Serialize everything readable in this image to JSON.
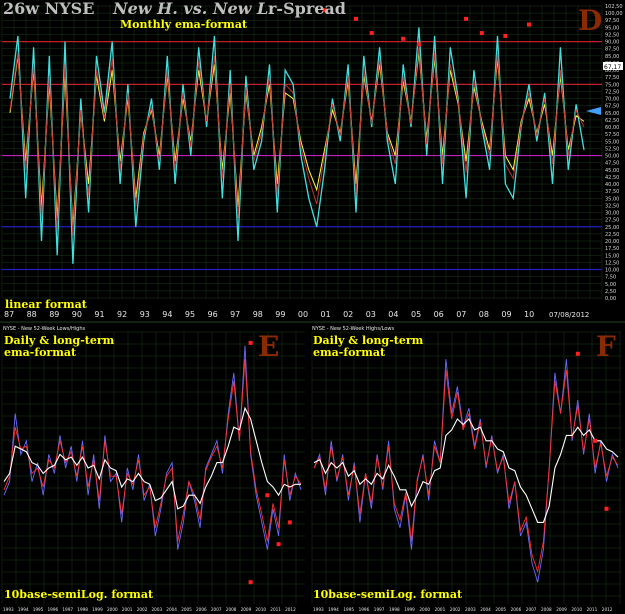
{
  "chart_data": [
    {
      "type": "line",
      "panel": "D",
      "title": "26w NYSE",
      "title_italic": "New H. vs. New L.",
      "title_suffix": "r-Spread",
      "subtitle": "Monthly ema-format",
      "format_label": "linear format",
      "date_label": "07/08/2012",
      "current_value_label": "67,17",
      "panel_letter": "D",
      "x_tick_labels": [
        "87",
        "88",
        "89",
        "90",
        "91",
        "92",
        "93",
        "94",
        "95",
        "96",
        "97",
        "98",
        "99",
        "00",
        "01",
        "02",
        "03",
        "04",
        "05",
        "06",
        "07",
        "08",
        "09",
        "10"
      ],
      "ylim": [
        0,
        102.5
      ],
      "y_tick_labels": [
        "102,50",
        "100,00",
        "97,50",
        "95,00",
        "92,50",
        "90,00",
        "87,50",
        "85,00",
        "82,50",
        "80,00",
        "77,50",
        "75,00",
        "72,50",
        "70,00",
        "67,50",
        "65,00",
        "62,50",
        "60,00",
        "57,50",
        "55,00",
        "52,50",
        "50,00",
        "47,50",
        "45,00",
        "42,50",
        "40,00",
        "37,50",
        "35,00",
        "32,50",
        "30,00",
        "27,50",
        "25,00",
        "22,50",
        "20,00",
        "17,50",
        "15,00",
        "12,50",
        "10,00",
        "7,50",
        "5,00",
        "2,50",
        "0,00"
      ],
      "reference_lines": [
        {
          "value": 90,
          "color": "#c0202a"
        },
        {
          "value": 75,
          "color": "#c0202a"
        },
        {
          "value": 50,
          "color": "#c020c0"
        },
        {
          "value": 25,
          "color": "#2020c0"
        },
        {
          "value": 10,
          "color": "#2020c0"
        }
      ],
      "series": [
        {
          "color": "#40e0e0",
          "values": [
            70,
            92,
            35,
            88,
            20,
            85,
            15,
            90,
            12,
            70,
            30,
            85,
            65,
            90,
            40,
            75,
            25,
            55,
            70,
            45,
            85,
            40,
            75,
            50,
            88,
            60,
            92,
            35,
            80,
            20,
            78,
            45,
            55,
            82,
            30,
            80,
            75,
            50,
            35,
            25,
            45,
            70,
            55,
            82,
            30,
            85,
            60,
            88,
            55,
            40,
            82,
            60,
            95,
            50,
            92,
            40,
            88,
            70,
            35,
            80,
            60,
            45,
            92,
            40,
            35,
            60,
            75,
            55,
            72,
            40,
            88,
            45,
            68,
            52
          ]
        },
        {
          "color": "#ffff40",
          "values": [
            65,
            85,
            48,
            80,
            32,
            75,
            28,
            78,
            25,
            65,
            40,
            78,
            62,
            80,
            48,
            70,
            35,
            58,
            66,
            50,
            78,
            48,
            70,
            55,
            80,
            62,
            82,
            45,
            72,
            32,
            72,
            50,
            60,
            75,
            40,
            72,
            70,
            55,
            45,
            38,
            52,
            66,
            58,
            76,
            40,
            78,
            62,
            82,
            58,
            50,
            76,
            62,
            86,
            56,
            84,
            50,
            80,
            68,
            48,
            74,
            62,
            52,
            84,
            50,
            45,
            62,
            70,
            58,
            68,
            50,
            78,
            52,
            64,
            62
          ]
        },
        {
          "color": "#c03030",
          "values": [
            66,
            86,
            45,
            82,
            28,
            78,
            24,
            82,
            22,
            66,
            36,
            80,
            63,
            84,
            45,
            72,
            32,
            57,
            67,
            48,
            80,
            45,
            72,
            53,
            83,
            62,
            85,
            42,
            75,
            28,
            74,
            48,
            58,
            78,
            36,
            75,
            72,
            53,
            42,
            33,
            50,
            68,
            57,
            78,
            36,
            80,
            61,
            84,
            57,
            47,
            78,
            61,
            88,
            54,
            86,
            47,
            82,
            69,
            44,
            76,
            61,
            50,
            86,
            47,
            42,
            61,
            72,
            57,
            70,
            47,
            80,
            50,
            66,
            60
          ]
        }
      ]
    },
    {
      "type": "line",
      "panel": "E",
      "header": "NYSE - New 52-Week Lows/Highs",
      "subtitle": "Daily & long-term",
      "subtitle2": "ema-format",
      "format_label": "10base-semiLog. format",
      "panel_letter": "E",
      "x_tick_labels": [
        "1993",
        "1994",
        "1995",
        "1996",
        "1997",
        "1998",
        "1999",
        "2000",
        "2001",
        "2002",
        "2003",
        "2004",
        "2005",
        "2006",
        "2007",
        "2008",
        "2009",
        "2010",
        "2011",
        "2012"
      ],
      "series": [
        {
          "color": "#6a6aff",
          "values": [
            40,
            45,
            70,
            55,
            60,
            45,
            52,
            40,
            55,
            48,
            62,
            50,
            58,
            45,
            60,
            40,
            55,
            35,
            62,
            45,
            48,
            30,
            50,
            42,
            55,
            38,
            44,
            25,
            35,
            48,
            52,
            20,
            30,
            45,
            38,
            28,
            50,
            55,
            60,
            48,
            70,
            85,
            60,
            95,
            55,
            40,
            30,
            20,
            35,
            25,
            55,
            38,
            48,
            42
          ]
        },
        {
          "color": "#ff3030",
          "values": [
            42,
            47,
            65,
            57,
            58,
            48,
            50,
            43,
            53,
            50,
            60,
            52,
            56,
            47,
            58,
            43,
            53,
            38,
            60,
            47,
            47,
            33,
            48,
            44,
            53,
            40,
            43,
            28,
            37,
            47,
            50,
            23,
            33,
            45,
            40,
            31,
            49,
            54,
            58,
            50,
            68,
            82,
            60,
            90,
            56,
            42,
            33,
            23,
            37,
            28,
            53,
            40,
            47,
            44
          ]
        },
        {
          "color": "#ffffff",
          "values": [
            45,
            48,
            58,
            57,
            56,
            52,
            51,
            48,
            50,
            51,
            55,
            53,
            54,
            51,
            54,
            50,
            51,
            46,
            53,
            50,
            49,
            43,
            46,
            45,
            48,
            45,
            44,
            38,
            39,
            42,
            45,
            35,
            36,
            40,
            40,
            37,
            43,
            47,
            52,
            52,
            58,
            65,
            64,
            72,
            68,
            60,
            52,
            45,
            43,
            40,
            44,
            43,
            44,
            44
          ]
        }
      ],
      "markers": [
        {
          "x_index": 44,
          "y": 96
        },
        {
          "x_index": 47,
          "y": 40
        },
        {
          "x_index": 49,
          "y": 22
        },
        {
          "x_index": 51,
          "y": 30
        },
        {
          "x_index": 44,
          "y": 8
        }
      ]
    },
    {
      "type": "line",
      "panel": "F",
      "header": "NYSE - New 52-Week Highs/Lows",
      "subtitle": "Daily & long-term",
      "subtitle2": "ema-format",
      "format_label": "10base-semiLog. format",
      "panel_letter": "F",
      "x_tick_labels": [
        "1993",
        "1994",
        "1995",
        "1996",
        "1997",
        "1998",
        "1999",
        "2000",
        "2001",
        "2002",
        "2003",
        "2004",
        "2005",
        "2006",
        "2007",
        "2008",
        "2009",
        "2010",
        "2011",
        "2012"
      ],
      "series": [
        {
          "color": "#6a6aff",
          "values": [
            50,
            55,
            40,
            60,
            45,
            55,
            38,
            52,
            30,
            48,
            35,
            55,
            42,
            60,
            35,
            28,
            40,
            20,
            45,
            55,
            38,
            60,
            52,
            90,
            70,
            80,
            65,
            72,
            58,
            68,
            50,
            62,
            48,
            55,
            35,
            45,
            25,
            30,
            15,
            8,
            20,
            50,
            85,
            70,
            90,
            60,
            75,
            55,
            70,
            48,
            60,
            45,
            55,
            50
          ]
        },
        {
          "color": "#ff3030",
          "values": [
            50,
            54,
            42,
            58,
            46,
            54,
            40,
            51,
            33,
            48,
            37,
            54,
            43,
            58,
            37,
            31,
            41,
            23,
            46,
            54,
            40,
            58,
            52,
            86,
            68,
            78,
            64,
            70,
            57,
            67,
            51,
            61,
            49,
            54,
            37,
            45,
            27,
            32,
            18,
            12,
            23,
            50,
            82,
            70,
            86,
            61,
            73,
            56,
            68,
            50,
            59,
            47,
            54,
            51
          ]
        },
        {
          "color": "#ffffff",
          "values": [
            52,
            53,
            48,
            52,
            50,
            52,
            47,
            49,
            44,
            46,
            44,
            48,
            46,
            51,
            47,
            42,
            42,
            36,
            40,
            45,
            44,
            49,
            50,
            62,
            64,
            68,
            66,
            68,
            64,
            65,
            60,
            60,
            57,
            56,
            50,
            49,
            43,
            40,
            35,
            30,
            30,
            36,
            50,
            55,
            62,
            62,
            65,
            62,
            64,
            60,
            60,
            57,
            56,
            54
          ]
        }
      ],
      "markers": [
        {
          "x_index": 46,
          "y": 92
        },
        {
          "x_index": 49,
          "y": 60
        },
        {
          "x_index": 51,
          "y": 35
        }
      ]
    }
  ],
  "colors": {
    "background": "#000000",
    "grid": "#1a3a1a",
    "title": "#bfbfbf",
    "subtitle": "#ffff00",
    "marker": "#ff2020",
    "arrow": "#40a0ff"
  }
}
